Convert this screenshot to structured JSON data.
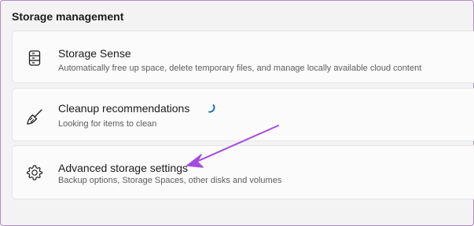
{
  "section": {
    "title": "Storage management"
  },
  "items": [
    {
      "title": "Storage Sense",
      "subtitle": "Automatically free up space, delete temporary files, and manage locally available cloud content",
      "icon": "storage-drive-icon"
    },
    {
      "title": "Cleanup recommendations",
      "subtitle": "Looking for items to clean",
      "icon": "broom-icon",
      "loading": true
    },
    {
      "title": "Advanced storage settings",
      "subtitle": "Backup options, Storage Spaces, other disks and volumes",
      "icon": "gear-icon"
    }
  ],
  "colors": {
    "background": "#f3f3f3",
    "card": "#fbfbfb",
    "accent": "#0067c0",
    "annotation_arrow": "#a24be0"
  }
}
